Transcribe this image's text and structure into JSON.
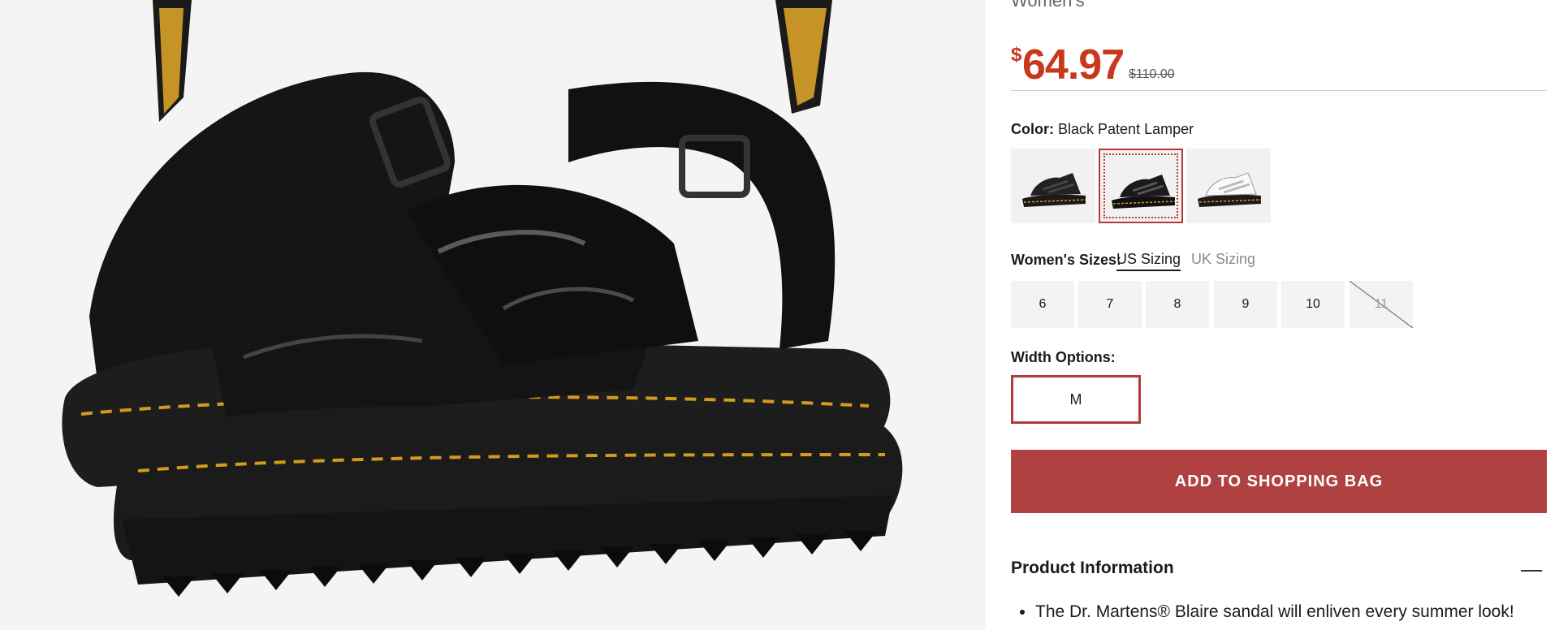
{
  "product": {
    "category": "Women's",
    "price": {
      "currency_symbol": "$",
      "current": "64.97",
      "original": "$110.00"
    },
    "color": {
      "label": "Color:",
      "value": "Black Patent Lamper",
      "swatches": [
        {
          "name": "Black",
          "selected": false
        },
        {
          "name": "Black Patent Lamper",
          "selected": true
        },
        {
          "name": "White",
          "selected": false
        }
      ]
    },
    "sizes": {
      "label": "Women's Sizes:",
      "tabs": [
        "US Sizing",
        "UK Sizing"
      ],
      "active_tab": "US Sizing",
      "options": [
        {
          "value": "6",
          "available": true
        },
        {
          "value": "7",
          "available": true
        },
        {
          "value": "8",
          "available": true
        },
        {
          "value": "9",
          "available": true
        },
        {
          "value": "10",
          "available": true
        },
        {
          "value": "11",
          "available": false
        }
      ]
    },
    "width": {
      "label": "Width Options:",
      "options": [
        "M"
      ],
      "selected": "M"
    },
    "add_to_bag": "ADD TO SHOPPING BAG",
    "info": {
      "title": "Product Information",
      "toggle_icon": "minus-icon",
      "bullets": [
        "The Dr. Martens® Blaire sandal will enliven every summer look!"
      ]
    }
  },
  "colors": {
    "price": "#c8381b",
    "accent": "#b43a3a",
    "button": "#b04141"
  }
}
